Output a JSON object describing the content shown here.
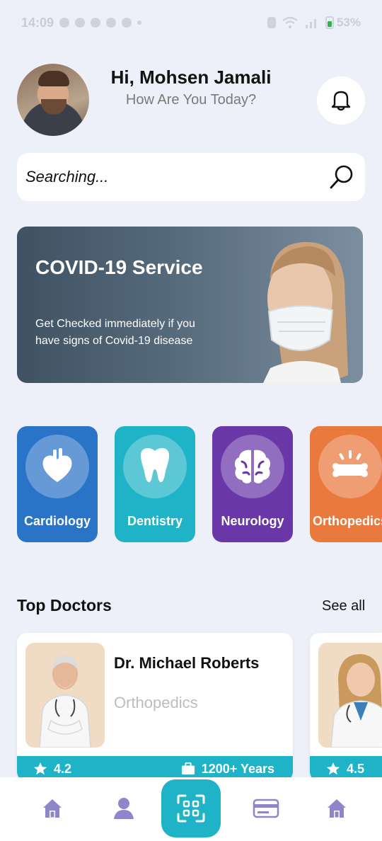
{
  "status_bar": {
    "time": "14:09",
    "battery": "53%"
  },
  "header": {
    "greeting": "Hi, Mohsen Jamali",
    "subtitle": "How Are You Today?"
  },
  "search": {
    "placeholder": "Searching..."
  },
  "banner": {
    "title": "COVID-19 Service",
    "description": "Get Checked immediately if you have signs of Covid-19 disease"
  },
  "categories": [
    {
      "label": "Cardiology",
      "icon": "heart-icon",
      "color": "#2a74c7"
    },
    {
      "label": "Dentistry",
      "icon": "tooth-icon",
      "color": "#1eb3c7"
    },
    {
      "label": "Neurology",
      "icon": "brain-icon",
      "color": "#6937a8"
    },
    {
      "label": "Orthopedics",
      "icon": "bone-icon",
      "color": "#e9793d"
    }
  ],
  "top_doctors": {
    "title": "Top Doctors",
    "see_all": "See all",
    "doctors": [
      {
        "name": "Dr. Michael Roberts",
        "specialty": "Orthopedics",
        "rating": "4.2",
        "experience": "1200+ Years"
      },
      {
        "name": "",
        "specialty": "",
        "rating": "4.5",
        "experience": ""
      }
    ]
  },
  "bottom_nav": {
    "items": [
      "home-icon",
      "profile-icon",
      "scan-icon",
      "card-icon",
      "home-icon"
    ],
    "accent": "#1eb3c7",
    "icon_color": "#8e86c9"
  }
}
